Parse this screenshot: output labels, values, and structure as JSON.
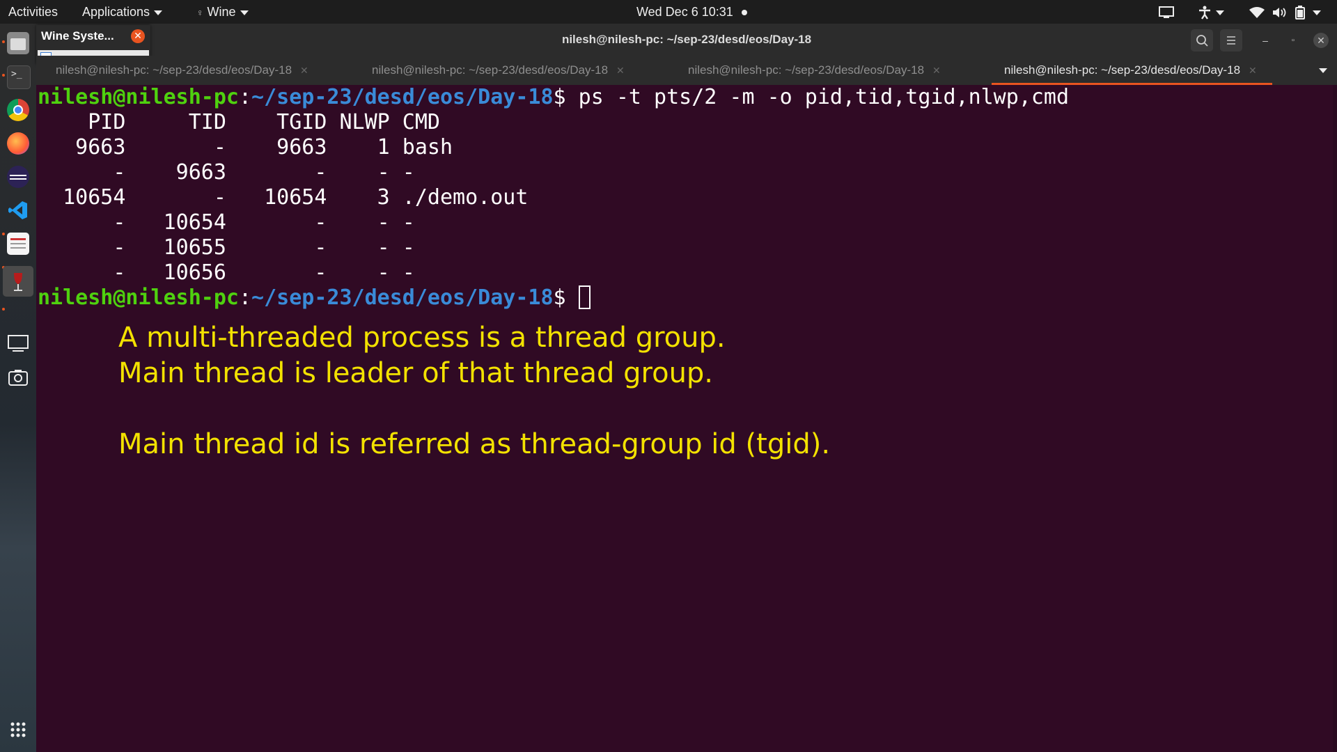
{
  "topbar": {
    "activities": "Activities",
    "applications": "Applications",
    "wine_menu": "Wine",
    "clock": "Wed Dec 6  10:31"
  },
  "dock": {
    "items": [
      "files-icon",
      "terminal-icon",
      "chrome-icon",
      "firefox-icon",
      "eclipse-icon",
      "vscode-icon",
      "text-editor-icon",
      "wine-icon",
      "display-icon",
      "screenshot-icon",
      "app-grid-icon"
    ]
  },
  "wine_popup": {
    "title": "Wine Syste..."
  },
  "window": {
    "title": "nilesh@nilesh-pc: ~/sep-23/desd/eos/Day-18"
  },
  "tabs": [
    {
      "label": "nilesh@nilesh-pc: ~/sep-23/desd/eos/Day-18",
      "active": false
    },
    {
      "label": "nilesh@nilesh-pc: ~/sep-23/desd/eos/Day-18",
      "active": false
    },
    {
      "label": "nilesh@nilesh-pc: ~/sep-23/desd/eos/Day-18",
      "active": false
    },
    {
      "label": "nilesh@nilesh-pc: ~/sep-23/desd/eos/Day-18",
      "active": true
    }
  ],
  "terminal": {
    "prompt_user": "nilesh@nilesh-pc",
    "prompt_sep": ":",
    "prompt_path": "~/sep-23/desd/eos/Day-18",
    "prompt_end": "$ ",
    "command": "ps -t pts/2 -m -o pid,tid,tgid,nlwp,cmd",
    "output": [
      "    PID     TID    TGID NLWP CMD",
      "   9663       -    9663    1 bash",
      "      -    9663       -    - -",
      "  10654       -   10654    3 ./demo.out",
      "      -   10654       -    - -",
      "      -   10655       -    - -",
      "      -   10656       -    - -"
    ]
  },
  "notes": [
    "A multi-threaded process is a thread group.",
    "Main thread is leader of that thread group.",
    "Main thread id is referred as thread-group id (tgid)."
  ]
}
